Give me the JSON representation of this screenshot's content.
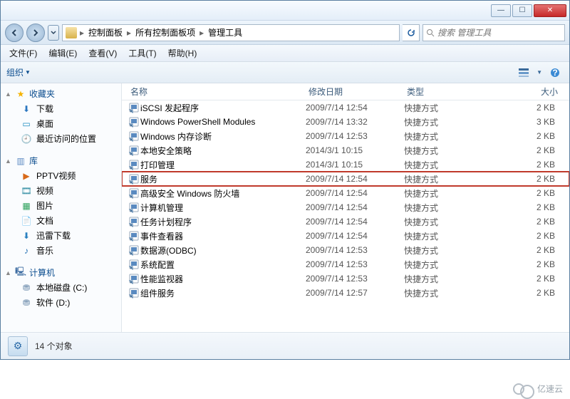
{
  "titlebar": {
    "min": "—",
    "max": "☐",
    "close": "✕"
  },
  "breadcrumb": {
    "seg1": "控制面板",
    "seg2": "所有控制面板项",
    "seg3": "管理工具",
    "sep": "▸"
  },
  "search": {
    "placeholder": "搜索 管理工具"
  },
  "menu": {
    "file": "文件(F)",
    "edit": "编辑(E)",
    "view": "查看(V)",
    "tools": "工具(T)",
    "help": "帮助(H)"
  },
  "toolbar": {
    "organize": "组织",
    "dd": "▼"
  },
  "sidebar": {
    "fav": "收藏夹",
    "fav_items": [
      {
        "ico": "⬇",
        "cls": "dl",
        "label": "下载"
      },
      {
        "ico": "▭",
        "cls": "desk",
        "label": "桌面"
      },
      {
        "ico": "🕘",
        "cls": "recent",
        "label": "最近访问的位置"
      }
    ],
    "lib": "库",
    "lib_items": [
      {
        "ico": "▶",
        "cls": "pptv",
        "label": "PPTV视频"
      },
      {
        "ico": "🎞",
        "cls": "vid",
        "label": "视频"
      },
      {
        "ico": "▦",
        "cls": "pic",
        "label": "图片"
      },
      {
        "ico": "📄",
        "cls": "doc",
        "label": "文档"
      },
      {
        "ico": "⬇",
        "cls": "xl",
        "label": "迅雷下载"
      },
      {
        "ico": "♪",
        "cls": "mus",
        "label": "音乐"
      }
    ],
    "comp": "计算机",
    "comp_items": [
      {
        "ico": "⛃",
        "cls": "disk",
        "label": "本地磁盘 (C:)"
      },
      {
        "ico": "⛃",
        "cls": "disk",
        "label": "软件 (D:)"
      }
    ]
  },
  "columns": {
    "name": "名称",
    "date": "修改日期",
    "type": "类型",
    "size": "大小"
  },
  "rows": [
    {
      "name": "iSCSI 发起程序",
      "date": "2009/7/14 12:54",
      "type": "快捷方式",
      "size": "2 KB",
      "hl": false
    },
    {
      "name": "Windows PowerShell Modules",
      "date": "2009/7/14 13:32",
      "type": "快捷方式",
      "size": "3 KB",
      "hl": false
    },
    {
      "name": "Windows 内存诊断",
      "date": "2009/7/14 12:53",
      "type": "快捷方式",
      "size": "2 KB",
      "hl": false
    },
    {
      "name": "本地安全策略",
      "date": "2014/3/1 10:15",
      "type": "快捷方式",
      "size": "2 KB",
      "hl": false
    },
    {
      "name": "打印管理",
      "date": "2014/3/1 10:15",
      "type": "快捷方式",
      "size": "2 KB",
      "hl": false
    },
    {
      "name": "服务",
      "date": "2009/7/14 12:54",
      "type": "快捷方式",
      "size": "2 KB",
      "hl": true
    },
    {
      "name": "高级安全 Windows 防火墙",
      "date": "2009/7/14 12:54",
      "type": "快捷方式",
      "size": "2 KB",
      "hl": false
    },
    {
      "name": "计算机管理",
      "date": "2009/7/14 12:54",
      "type": "快捷方式",
      "size": "2 KB",
      "hl": false
    },
    {
      "name": "任务计划程序",
      "date": "2009/7/14 12:54",
      "type": "快捷方式",
      "size": "2 KB",
      "hl": false
    },
    {
      "name": "事件查看器",
      "date": "2009/7/14 12:54",
      "type": "快捷方式",
      "size": "2 KB",
      "hl": false
    },
    {
      "name": "数据源(ODBC)",
      "date": "2009/7/14 12:53",
      "type": "快捷方式",
      "size": "2 KB",
      "hl": false
    },
    {
      "name": "系统配置",
      "date": "2009/7/14 12:53",
      "type": "快捷方式",
      "size": "2 KB",
      "hl": false
    },
    {
      "name": "性能监视器",
      "date": "2009/7/14 12:53",
      "type": "快捷方式",
      "size": "2 KB",
      "hl": false
    },
    {
      "name": "组件服务",
      "date": "2009/7/14 12:57",
      "type": "快捷方式",
      "size": "2 KB",
      "hl": false
    }
  ],
  "status": {
    "count": "14 个对象"
  },
  "watermark": "亿速云"
}
